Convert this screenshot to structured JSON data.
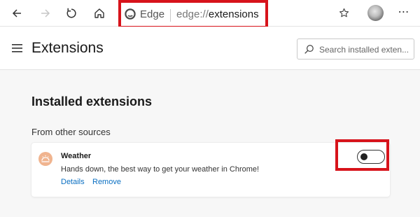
{
  "browser": {
    "site_name": "Edge",
    "url_scheme": "edge://",
    "url_host": "extensions",
    "more_menu": "⋯",
    "icons": {
      "back": "arrow-left-icon",
      "forward": "arrow-right-icon",
      "refresh": "refresh-icon",
      "home": "home-icon",
      "edge_logo": "edge-logo-icon",
      "favorite": "star-icon",
      "profile": "profile-avatar",
      "more": "more-icon"
    }
  },
  "header": {
    "menu_icon": "hamburger-icon",
    "title": "Extensions",
    "search_placeholder": "Search installed exten..."
  },
  "main": {
    "section_title": "Installed extensions",
    "subsection_title": "From other sources",
    "extensions": [
      {
        "name": "Weather",
        "description": "Hands down, the best way to get your weather in Chrome!",
        "details_label": "Details",
        "remove_label": "Remove",
        "enabled": false
      }
    ]
  },
  "colors": {
    "highlight": "#d7131b",
    "link": "#0a6fc2",
    "extension_icon": "#f0b48f"
  }
}
